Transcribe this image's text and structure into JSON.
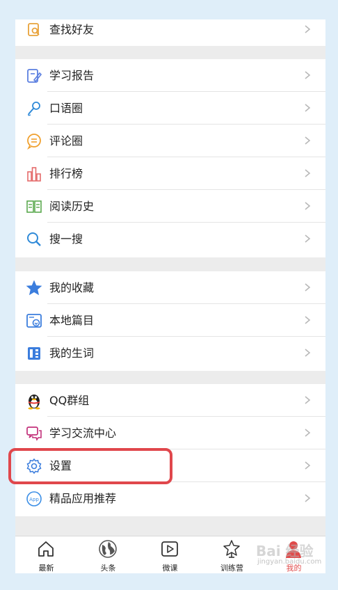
{
  "menu": {
    "top": [
      {
        "label": "查找好友",
        "icon": "find-friends-icon"
      }
    ],
    "group1": [
      {
        "label": "学习报告",
        "icon": "study-report-icon"
      },
      {
        "label": "口语圈",
        "icon": "microphone-icon"
      },
      {
        "label": "评论圈",
        "icon": "comment-bubble-icon"
      },
      {
        "label": "排行榜",
        "icon": "ranking-chart-icon"
      },
      {
        "label": "阅读历史",
        "icon": "open-book-icon"
      },
      {
        "label": "搜一搜",
        "icon": "search-icon"
      }
    ],
    "group2": [
      {
        "label": "我的收藏",
        "icon": "star-icon"
      },
      {
        "label": "本地篇目",
        "icon": "download-doc-icon"
      },
      {
        "label": "我的生词",
        "icon": "vocabulary-book-icon"
      }
    ],
    "group3": [
      {
        "label": "QQ群组",
        "icon": "qq-penguin-icon"
      },
      {
        "label": "学习交流中心",
        "icon": "chat-bubbles-icon"
      },
      {
        "label": "设置",
        "icon": "gear-icon"
      },
      {
        "label": "精品应用推荐",
        "icon": "app-badge-icon"
      }
    ]
  },
  "tabs": [
    {
      "label": "最新",
      "icon": "home-icon"
    },
    {
      "label": "头条",
      "icon": "globe-icon"
    },
    {
      "label": "微课",
      "icon": "play-icon"
    },
    {
      "label": "训练营",
      "icon": "trophy-icon"
    },
    {
      "label": "我的",
      "icon": "person-icon",
      "active": true
    }
  ],
  "watermark": {
    "text": "Bai 经验",
    "sub": "jingyan.baidu.com"
  },
  "colors": {
    "highlight": "#e0474c",
    "active_tab": "#e04a4a",
    "accent_blue": "#3b7ddd"
  }
}
